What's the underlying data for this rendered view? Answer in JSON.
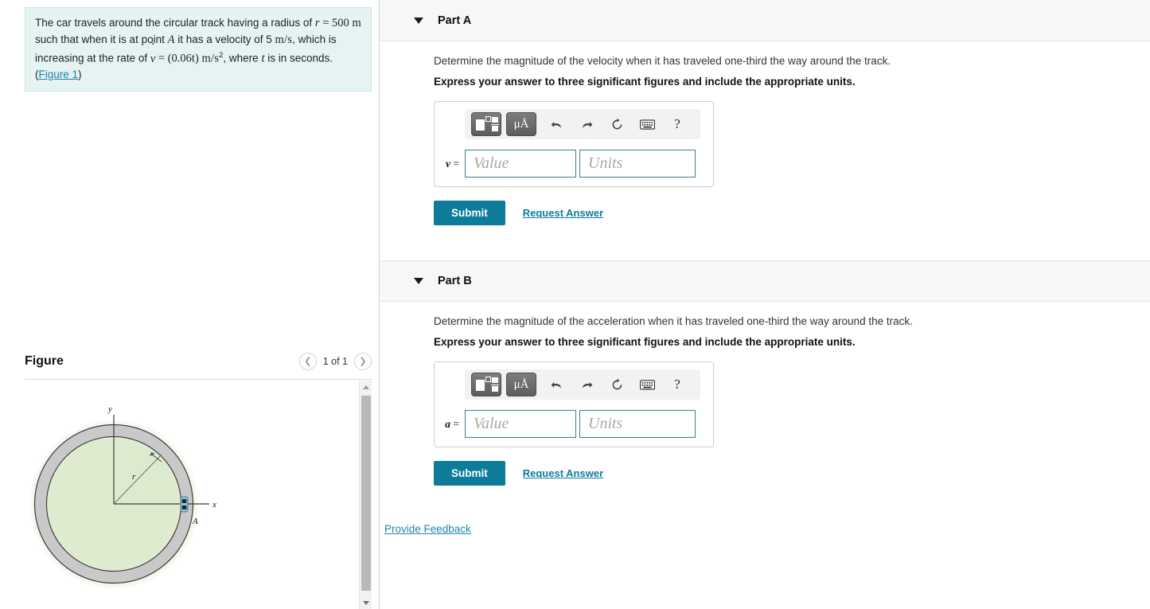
{
  "problem": {
    "line1_a": "The car travels around the circular track having a radius of ",
    "r_sym": "r",
    "eq": " = ",
    "r_val": "500",
    "r_unit": "m",
    "line2_a": "such that when it is at point ",
    "point": "A",
    "line2_b": " it has a velocity of 5 ",
    "v_unit": "m/s",
    "line2_c": ", which is",
    "line3_a": "increasing at the rate of ",
    "vdot": "v",
    "vdot_eq": " = ",
    "rate_expr": "(0.06t)",
    "rate_unit": "m/s",
    "rate_unit_sup": "2",
    "line3_b": ", where ",
    "t_sym": "t",
    "line3_c": " is in seconds.",
    "figure_link": "Figure 1"
  },
  "figure": {
    "title": "Figure",
    "pager_label": "1 of 1",
    "prev_icon": "chevron-left-icon",
    "next_icon": "chevron-right-icon",
    "diagram": {
      "axis_x_label": "x",
      "axis_y_label": "y",
      "radius_label": "r",
      "point_label": "A",
      "track_color": "#c9c9c9",
      "grass_color": "#d8e8c8",
      "car_color": "#5aa8c8"
    },
    "scrollbar": {
      "up_icon": "scroll-up-arrow-icon",
      "down_icon": "scroll-down-arrow-icon"
    }
  },
  "toolbar": {
    "template_icon": "math-template-icon",
    "units_label": "μÅ",
    "undo_icon": "undo-arrow-icon",
    "redo_icon": "redo-arrow-icon",
    "reset_icon": "reset-circular-arrow-icon",
    "keyboard_icon": "keyboard-icon",
    "help_label": "?"
  },
  "parts": [
    {
      "caret_icon": "caret-down-icon",
      "title": "Part A",
      "question": "Determine the magnitude of the velocity when it has traveled one-third the way around the track.",
      "instruction": "Express your answer to three significant figures and include the appropriate units.",
      "var_label": "v",
      "var_eq": "=",
      "value_placeholder": "Value",
      "units_placeholder": "Units",
      "value": "",
      "units": "",
      "submit_label": "Submit",
      "request_label": "Request Answer"
    },
    {
      "caret_icon": "caret-down-icon",
      "title": "Part B",
      "question": "Determine the magnitude of the acceleration when it has traveled one-third the way around the track.",
      "instruction": "Express your answer to three significant figures and include the appropriate units.",
      "var_label": "a",
      "var_eq": "=",
      "value_placeholder": "Value",
      "units_placeholder": "Units",
      "value": "",
      "units": "",
      "submit_label": "Submit",
      "request_label": "Request Answer"
    }
  ],
  "feedback": {
    "label": "Provide Feedback"
  },
  "colors": {
    "accent_teal": "#0d7c9b",
    "link_blue": "#1e87b0",
    "panel_cyan": "#e6f3f3",
    "header_gray": "#f7f7f7"
  }
}
